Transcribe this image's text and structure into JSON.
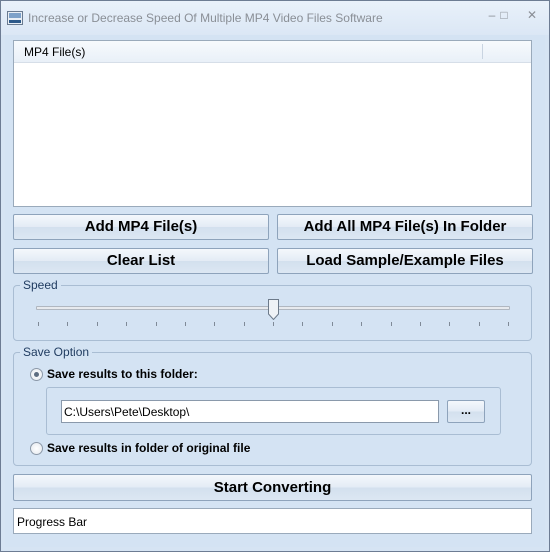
{
  "window": {
    "title": "Increase or Decrease Speed Of Multiple MP4 Video Files Software",
    "icon": "video-file-icon",
    "minimize_glyph": "–",
    "maximize_glyph": "□",
    "close_glyph": "✕"
  },
  "file_list": {
    "column_header": "MP4 File(s)",
    "items": []
  },
  "buttons": {
    "add_files": "Add MP4 File(s)",
    "add_folder": "Add All MP4 File(s) In Folder",
    "clear_list": "Clear List",
    "load_sample": "Load Sample/Example Files",
    "start": "Start Converting",
    "browse": "..."
  },
  "speed": {
    "label": "Speed",
    "value_fraction": 0.5,
    "tick_count": 17
  },
  "save_option": {
    "label": "Save Option",
    "option_folder": "Save results to this folder:",
    "option_original": "Save results in folder of original file",
    "selected": "folder",
    "folder_path": "C:\\Users\\Pete\\Desktop\\"
  },
  "progress": {
    "label": "Progress Bar",
    "value_fraction": 0
  },
  "colors": {
    "background": "#d4e3f3",
    "accent_text": "#1e3a5f"
  }
}
